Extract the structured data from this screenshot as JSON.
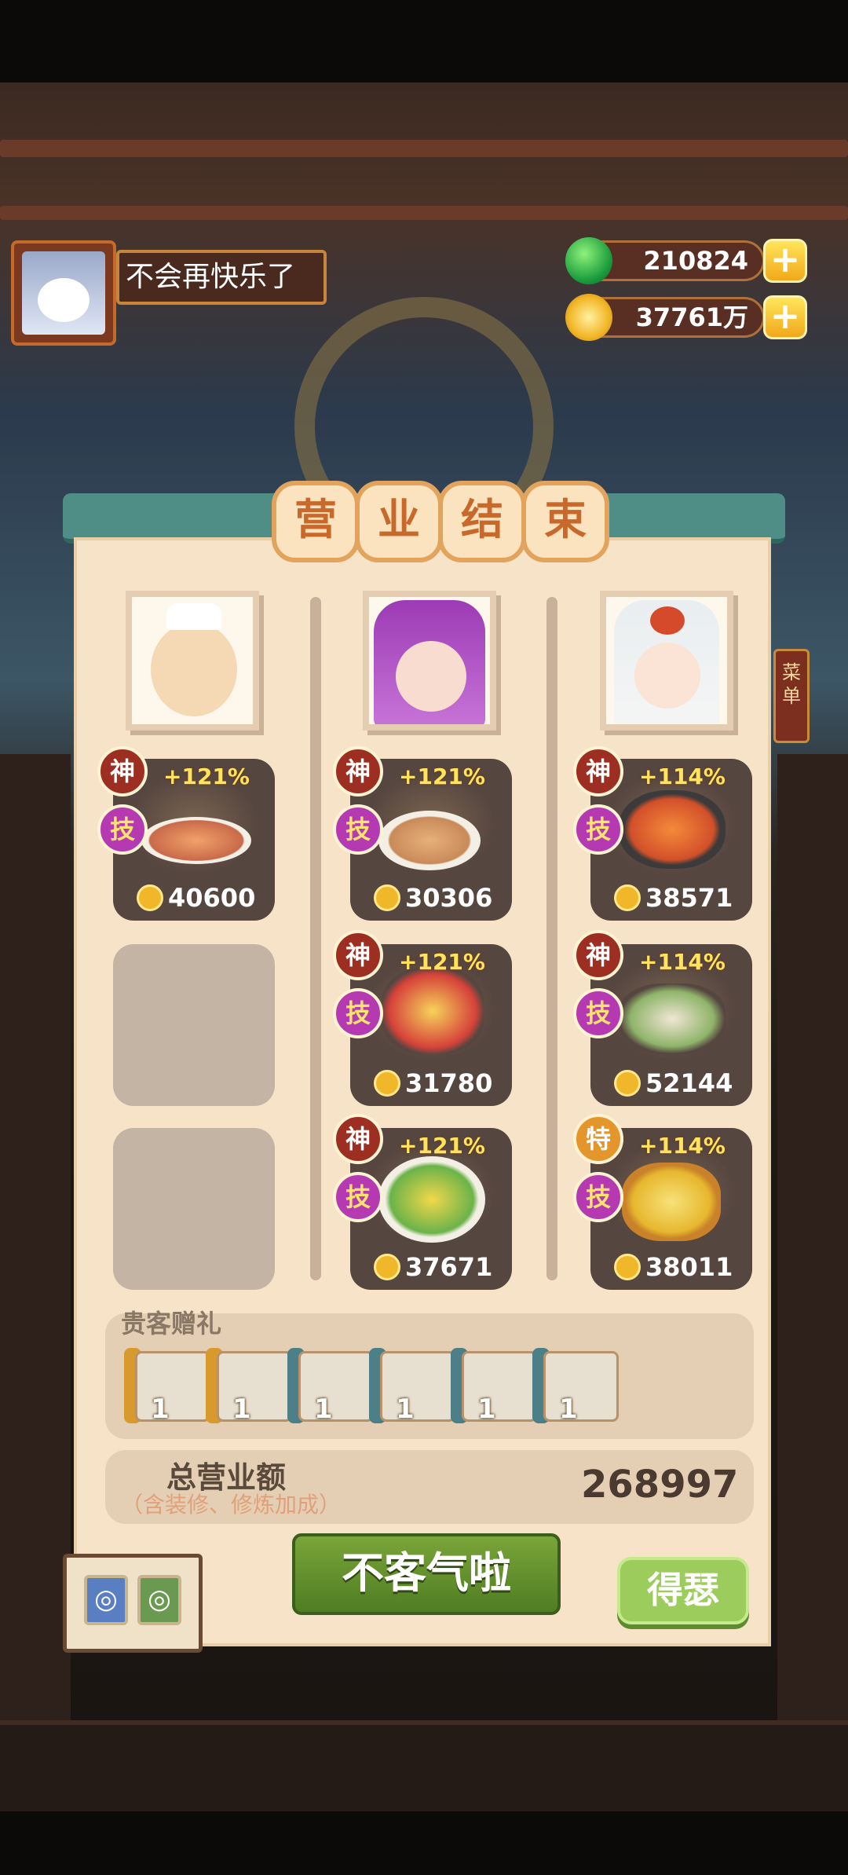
{
  "player": {
    "name": "不会再快乐了"
  },
  "resources": [
    {
      "icon": "green-jade-icon",
      "value": "210824"
    },
    {
      "icon": "gold-coin-icon",
      "value": "37761万"
    }
  ],
  "panel": {
    "title_chars": [
      "营",
      "业",
      "结",
      "束"
    ],
    "side_sign": "菜单",
    "columns": [
      {
        "customer": "mustache-gentleman-portrait",
        "dishes": [
          {
            "rank": "神",
            "tech": "技",
            "bonus": "+121%",
            "coins": "40600"
          }
        ]
      },
      {
        "customer": "purple-hair-girl-portrait",
        "dishes": [
          {
            "rank": "神",
            "tech": "技",
            "bonus": "+121%",
            "coins": "30306"
          },
          {
            "rank": "神",
            "tech": "技",
            "bonus": "+121%",
            "coins": "31780"
          },
          {
            "rank": "神",
            "tech": "技",
            "bonus": "+121%",
            "coins": "37671"
          }
        ]
      },
      {
        "customer": "white-hair-girl-portrait",
        "dishes": [
          {
            "rank": "神",
            "tech": "技",
            "bonus": "+114%",
            "coins": "38571"
          },
          {
            "rank": "神",
            "tech": "技",
            "bonus": "+114%",
            "coins": "52144"
          },
          {
            "rank": "特",
            "tech": "技",
            "bonus": "+114%",
            "coins": "38011"
          }
        ]
      }
    ],
    "gifts": {
      "label": "贵客赠礼",
      "items": [
        {
          "count": "1",
          "color": "#d89a2c"
        },
        {
          "count": "1",
          "color": "#d89a2c"
        },
        {
          "count": "1",
          "color": "#4d7f88"
        },
        {
          "count": "1",
          "color": "#4d7f88"
        },
        {
          "count": "1",
          "color": "#4d7f88"
        },
        {
          "count": "1",
          "color": "#4d7f88"
        }
      ]
    },
    "total": {
      "label": "总营业额",
      "note": "（含装修、修炼加成）",
      "value": "268997"
    },
    "buttons": {
      "main": "不客气啦",
      "side": "得瑟"
    }
  },
  "colors": {
    "accent_red": "#d0502a",
    "title_orange": "#c8682a",
    "bonus_yellow": "#ffe25e"
  }
}
